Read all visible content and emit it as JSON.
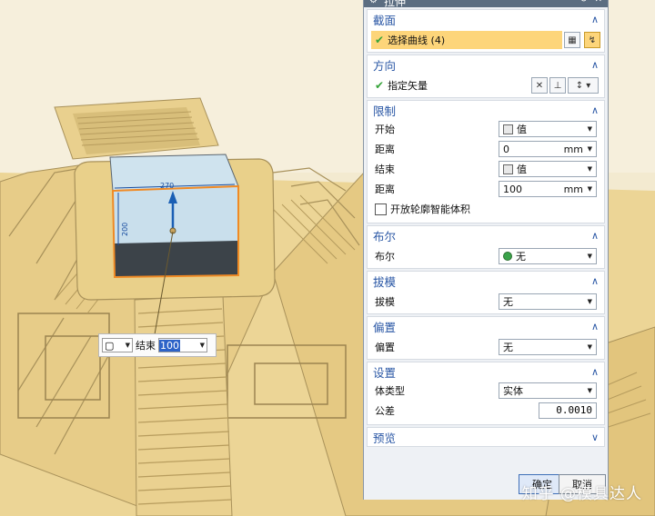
{
  "dialog": {
    "title": "拉伸",
    "sections": {
      "section_curve": {
        "title": "截面",
        "select_curve": "选择曲线 (4)"
      },
      "direction": {
        "title": "方向",
        "specify_vector": "指定矢量"
      },
      "limits": {
        "title": "限制",
        "start_label": "开始",
        "start_value": "值",
        "start_distance_label": "距离",
        "start_distance": "0",
        "start_unit": "mm",
        "end_label": "结束",
        "end_value": "值",
        "end_distance_label": "距离",
        "end_distance": "100",
        "end_unit": "mm",
        "open_profile_label": "开放轮廓智能体积"
      },
      "boolean": {
        "title": "布尔",
        "label": "布尔",
        "value": "无"
      },
      "draft": {
        "title": "拔模",
        "label": "拔模",
        "value": "无"
      },
      "offset": {
        "title": "偏置",
        "label": "偏置",
        "value": "无"
      },
      "settings": {
        "title": "设置",
        "body_type_label": "体类型",
        "body_type": "实体",
        "tolerance_label": "公差",
        "tolerance": "0.0010"
      },
      "preview": {
        "title": "预览"
      }
    },
    "buttons": {
      "ok": "确定",
      "cancel": "取消"
    }
  },
  "canvas": {
    "dimension_x": "270",
    "dimension_y": "200",
    "float_input_label": "结束",
    "float_input_value": "100"
  },
  "watermark": "知乎 @模具达人",
  "colors": {
    "model_yellow": "#efd99a",
    "selection_orange": "#f08a24",
    "dialog_accent": "#2a57a5",
    "highlight": "#fdd57a"
  }
}
